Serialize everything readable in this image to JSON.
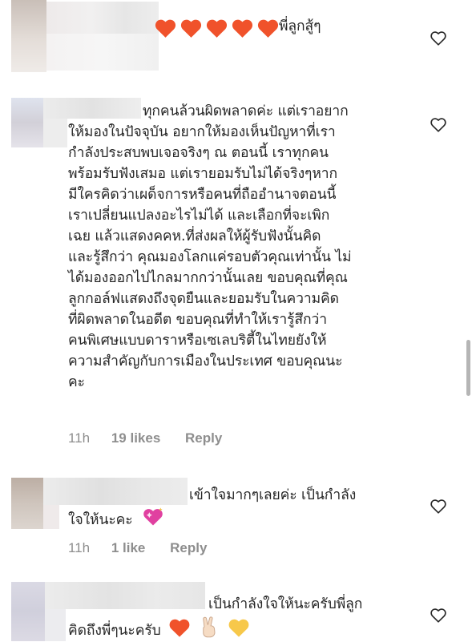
{
  "comments": [
    {
      "text_lines": [
        "พี่ลูกสู้ๆ"
      ],
      "time": "",
      "likes": "",
      "reply": "",
      "emoji_prefix": [
        "orange-heart",
        "orange-heart",
        "orange-heart",
        "orange-heart",
        "orange-heart"
      ]
    },
    {
      "text_lines": [
        "ทุกคนล้วนผิดพลาดค่ะ แต่เราอยาก",
        "ให้มองในปัจจุบัน อยากให้มองเห็นปัญหาที่เรา",
        "กำลังประสบพบเจอจริงๆ ณ ตอนนี้ เราทุกคน",
        "พร้อมรับฟังเสมอ แต่เรายอมรับไม่ได้จริงๆหาก",
        "มีใครคิดว่าเผด็จการหรือคนที่ถืออำนาจตอนนี้",
        "เราเปลี่ยนแปลงอะไรไม่ได้ และเลือกที่จะเพิก",
        "เฉย แล้วแสดงคคห.ที่ส่งผลให้ผู้รับฟังนั้นคิด",
        "และรู้สึกว่า คุณมองโลกแค่รอบตัวคุณเท่านั้น ไม่",
        "ได้มองออกไปไกลมากกว่านั้นเลย ขอบคุณที่คุณ",
        "ลูกกอล์ฟแสดงถึงจุดยืนและยอมรับในความคิด",
        "ที่ผิดพลาดในอดีต ขอบคุณที่ทำให้เรารู้สึกว่า",
        "คนพิเศษแบบดาราหรือเซเลบริตี้ในไทยยังให้",
        "ความสำคัญกับการเมืองในประเทศ ขอบคุณนะ",
        "คะ"
      ],
      "time": "11h",
      "likes": "19 likes",
      "reply": "Reply"
    },
    {
      "text_lines": [
        "เข้าใจมากๆเลยค่ะ เป็นกำลัง",
        "ใจให้นะคะ"
      ],
      "time": "11h",
      "likes": "1 like",
      "reply": "Reply"
    },
    {
      "text_lines": [
        "เป็นกำลังใจให้นะครับพี่ลูก",
        "คิดถึงพี่ๆนะครับ"
      ],
      "time": "",
      "likes": "",
      "reply": ""
    }
  ],
  "icons": {
    "like": "heart-outline-icon",
    "emoji_heart": "orange-heart-icon",
    "emoji_sparkle": "sparkling-heart-icon",
    "emoji_victory": "victory-hand-icon",
    "emoji_yellow": "yellow-heart-icon"
  },
  "colors": {
    "text": "#262626",
    "meta": "#8e8e8e",
    "orange_heart": "#f0522b",
    "yellow_heart": "#f7c84a",
    "pink_heart": "#e040a0"
  }
}
